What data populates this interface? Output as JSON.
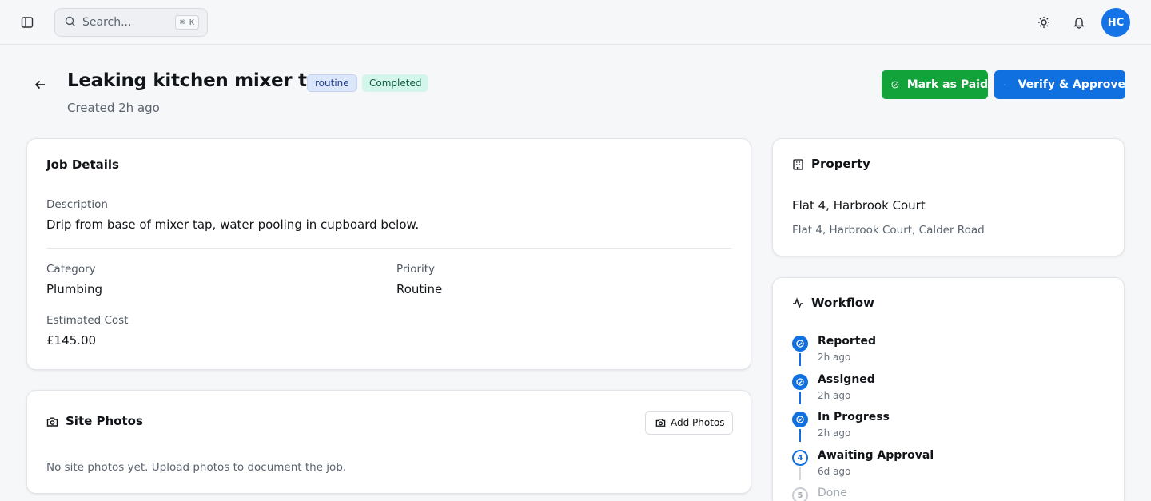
{
  "topbar": {
    "search_placeholder": "Search...",
    "search_shortcut": "⌘ K",
    "avatar_initials": "HC"
  },
  "header": {
    "title": "Leaking kitchen mixer tap",
    "priority_badge": "routine",
    "status_badge": "Completed",
    "created": "Created 2h ago",
    "mark_paid_label": "Mark as Paid",
    "verify_label": "Verify & Approve"
  },
  "job_details": {
    "title": "Job Details",
    "description_label": "Description",
    "description": "Drip from base of mixer tap, water pooling in cupboard below.",
    "category_label": "Category",
    "category": "Plumbing",
    "priority_label": "Priority",
    "priority": "Routine",
    "cost_label": "Estimated Cost",
    "cost": "£145.00"
  },
  "site_photos": {
    "title": "Site Photos",
    "add_label": "Add Photos",
    "empty_text": "No site photos yet. Upload photos to document the job."
  },
  "property": {
    "title": "Property",
    "name": "Flat 4, Harbrook Court",
    "address": "Flat 4, Harbrook Court, Calder Road"
  },
  "workflow": {
    "title": "Workflow",
    "steps": [
      {
        "name": "Reported",
        "time": "2h ago",
        "state": "done"
      },
      {
        "name": "Assigned",
        "time": "2h ago",
        "state": "done"
      },
      {
        "name": "In Progress",
        "time": "2h ago",
        "state": "done"
      },
      {
        "name": "Awaiting Approval",
        "time": "6d ago",
        "state": "current",
        "number": "4"
      },
      {
        "name": "Done",
        "state": "pending",
        "number": "5"
      }
    ]
  },
  "colors": {
    "accent": "#1070e0",
    "success": "#12a33a",
    "completed_badge_bg": "#d4f5ea",
    "routine_badge_bg": "#dbe6fb"
  }
}
